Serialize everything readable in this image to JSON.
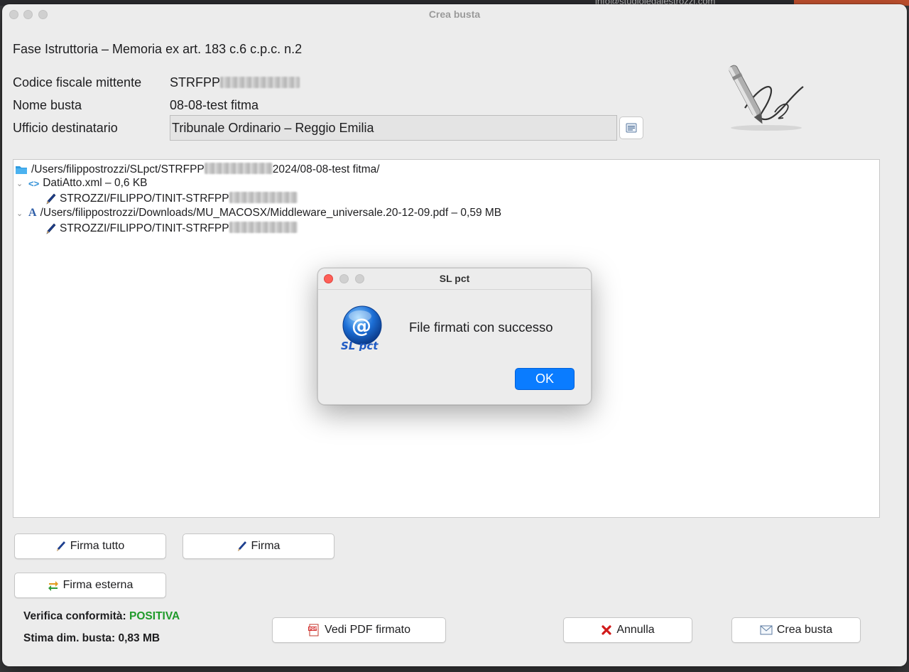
{
  "background": {
    "email_fragment": "info@studiolegalestrozzi.com"
  },
  "window": {
    "title": "Crea busta"
  },
  "header": {
    "fase": "Fase Istruttoria – Memoria ex art. 183 c.6 c.p.c. n.2",
    "codice_label": "Codice fiscale mittente",
    "codice_value": "STRFPP",
    "nome_label": "Nome busta",
    "nome_value": "08-08-test fitma",
    "ufficio_label": "Ufficio destinatario",
    "ufficio_value": "Tribunale Ordinario – Reggio Emilia"
  },
  "tree": {
    "root_prefix": "/Users/filippostrozzi/SLpct/STRFPP",
    "root_suffix": "2024/08-08-test fitma/",
    "item1": "DatiAtto.xml – 0,6 KB",
    "item1_sig": "STROZZI/FILIPPO/TINIT-STRFPP",
    "item2": "/Users/filippostrozzi/Downloads/MU_MACOSX/Middleware_universale.20-12-09.pdf – 0,59 MB",
    "item2_sig": "STROZZI/FILIPPO/TINIT-STRFPP"
  },
  "buttons": {
    "firma_tutto": "Firma tutto",
    "firma": "Firma",
    "firma_esterna": "Firma esterna",
    "vedi_pdf": "Vedi PDF firmato",
    "annulla": "Annulla",
    "crea_busta": "Crea busta"
  },
  "status": {
    "verifica_label": "Verifica conformità:",
    "verifica_value": "POSITIVA",
    "stima": "Stima dim. busta: 0,83 MB"
  },
  "dialog": {
    "title": "SL pct",
    "message": "File firmati con successo",
    "ok": "OK",
    "icon_text": "SL pct"
  },
  "colors": {
    "accent": "#0a7cff",
    "positive": "#1f9a2a",
    "close": "#fe5f57"
  }
}
